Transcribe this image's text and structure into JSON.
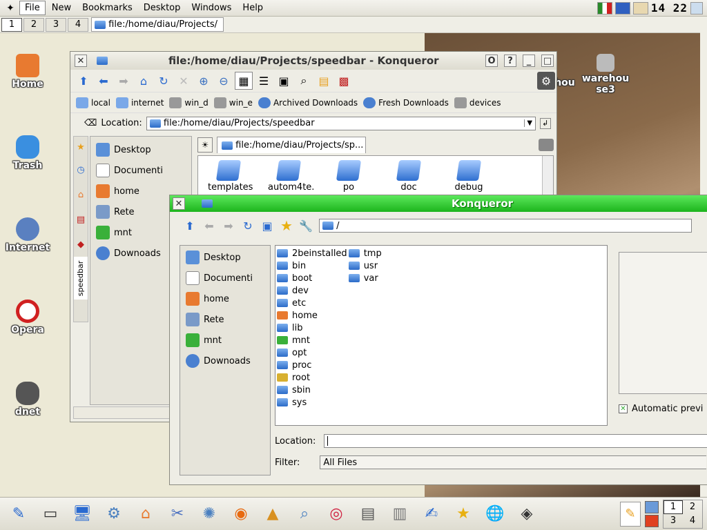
{
  "menubar": {
    "items": [
      "File",
      "New",
      "Bookmarks",
      "Desktop",
      "Windows",
      "Help"
    ],
    "clock": "14 22"
  },
  "taskbar": {
    "desktops": [
      "1",
      "2",
      "3",
      "4"
    ],
    "task_title": "file:/home/diau/Projects/"
  },
  "desktop_icons": [
    {
      "label": "Home",
      "icon": "home-icon",
      "color": "#e87a30"
    },
    {
      "label": "Trash",
      "icon": "trash-icon",
      "color": "#3a8fe0"
    },
    {
      "label": "Internet",
      "icon": "globe-icon",
      "color": "#5a80c0"
    },
    {
      "label": "Opera",
      "icon": "opera-icon",
      "color": "#d02020"
    },
    {
      "label": "dnet",
      "icon": "cow-icon",
      "color": "#444"
    }
  ],
  "desktop_right_icons": {
    "label1": "hou",
    "label2": "warehou",
    "label3": "se3"
  },
  "back_window": {
    "title": "file:/home/diau/Projects/speedbar - Konqueror",
    "title_buttons": [
      "O",
      "?",
      "_",
      "□"
    ],
    "bookmarks": [
      "local",
      "internet",
      "win_d",
      "win_e",
      "Archived Downloads",
      "Fresh Downloads",
      "devices"
    ],
    "location_label": "Location:",
    "location_value": "file:/home/diau/Projects/speedbar",
    "tab_label": "file:/home/diau/Projects/sp...",
    "side_tab": "speedbar",
    "sidebar_items": [
      "Desktop",
      "Documenti",
      "home",
      "Rete",
      "mnt",
      "Downoads"
    ],
    "folders": [
      "templates",
      "autom4te.",
      "po",
      "doc",
      "debug"
    ]
  },
  "front_window": {
    "title": "Konqueror",
    "path": "/",
    "sidebar_items": [
      "Desktop",
      "Documenti",
      "home",
      "Rete",
      "mnt",
      "Downoads"
    ],
    "files_col1": [
      "2beinstalled",
      "bin",
      "boot",
      "dev",
      "etc",
      "home",
      "lib",
      "mnt",
      "opt",
      "proc",
      "root",
      "sbin",
      "sys"
    ],
    "files_col2": [
      "tmp",
      "usr",
      "var"
    ],
    "preview_checkbox": "Automatic previ",
    "location_label": "Location:",
    "location_value": "",
    "filter_label": "Filter:",
    "filter_value": "All Files"
  },
  "panel": {
    "icons": [
      "kwrite-icon",
      "terminal-icon",
      "monitor-icon",
      "settings-icon",
      "home-icon",
      "tools-icon",
      "network-icon",
      "firefox-icon",
      "ark-icon",
      "search-icon",
      "cd-icon",
      "text-editor-icon",
      "harddisk-icon",
      "kwrite2-icon",
      "star-icon",
      "konqueror-icon",
      "floppy-icon"
    ],
    "pager": [
      "1",
      "2",
      "3",
      "4"
    ]
  }
}
